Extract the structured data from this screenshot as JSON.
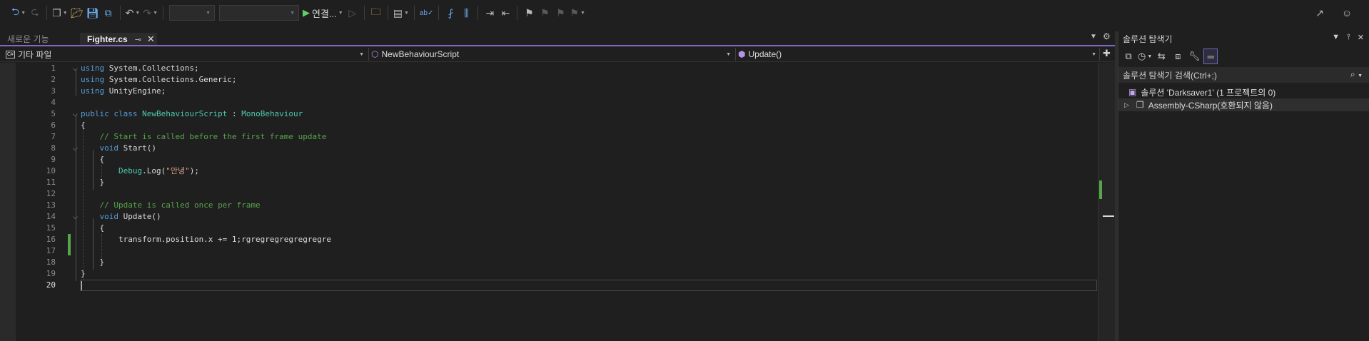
{
  "toolbar": {
    "start_label": "연결...",
    "icons": [
      "back-icon",
      "forward-icon",
      "new-project-icon",
      "open-folder-icon",
      "save-icon",
      "save-all-icon",
      "undo-icon",
      "redo-icon",
      "start-icon",
      "start-without-debug-icon",
      "folder-icon",
      "layout-icon",
      "spellcheck-icon",
      "indent-icon",
      "outdent-icon",
      "bookmark-icon",
      "share-icon",
      "person-icon"
    ]
  },
  "tabs": {
    "inactive_label": "새로운 기능",
    "active_label": "Fighter.cs",
    "pin": "⊸",
    "close": "✕"
  },
  "navbar": {
    "scope_badge": "C#",
    "scope": "기타 파일",
    "class": "NewBehaviourScript",
    "member": "Update()"
  },
  "editor": {
    "current_line": 20,
    "lines": [
      {
        "n": "1",
        "html": "<span class=\"kw\">using</span> System.Collections;"
      },
      {
        "n": "2",
        "html": "<span class=\"kw\">using</span> System.Collections.Generic;"
      },
      {
        "n": "3",
        "html": "<span class=\"kw\">using</span> UnityEngine;"
      },
      {
        "n": "4",
        "html": ""
      },
      {
        "n": "5",
        "html": "<span class=\"kw\">public class</span> <span class=\"ty\">NewBehaviourScript</span> : <span class=\"ty\">MonoBehaviour</span>"
      },
      {
        "n": "6",
        "html": "{"
      },
      {
        "n": "7",
        "html": "    <span class=\"cm\">// Start is called before the first frame update</span>"
      },
      {
        "n": "8",
        "html": "    <span class=\"kw\">void</span> Start()"
      },
      {
        "n": "9",
        "html": "    {"
      },
      {
        "n": "10",
        "html": "        <span class=\"ty\">Debug</span>.Log(<span class=\"st\">\"안녕\"</span>);"
      },
      {
        "n": "11",
        "html": "    }"
      },
      {
        "n": "12",
        "html": ""
      },
      {
        "n": "13",
        "html": "    <span class=\"cm\">// Update is called once per frame</span>"
      },
      {
        "n": "14",
        "html": "    <span class=\"kw\">void</span> Update()"
      },
      {
        "n": "15",
        "html": "    {"
      },
      {
        "n": "16",
        "html": "        transform.position.x += 1;rgregregregregregre"
      },
      {
        "n": "17",
        "html": ""
      },
      {
        "n": "18",
        "html": "    }"
      },
      {
        "n": "19",
        "html": "}"
      },
      {
        "n": "20",
        "html": ""
      }
    ]
  },
  "solution_explorer": {
    "title": "솔루션 탐색기",
    "search_placeholder": "솔루션 탐색기 검색(Ctrl+;)",
    "solution_node": "솔루션 'Darksaver1' (1 프로젝트의 0)",
    "project_node": "Assembly-CSharp(호환되지 않음)"
  }
}
